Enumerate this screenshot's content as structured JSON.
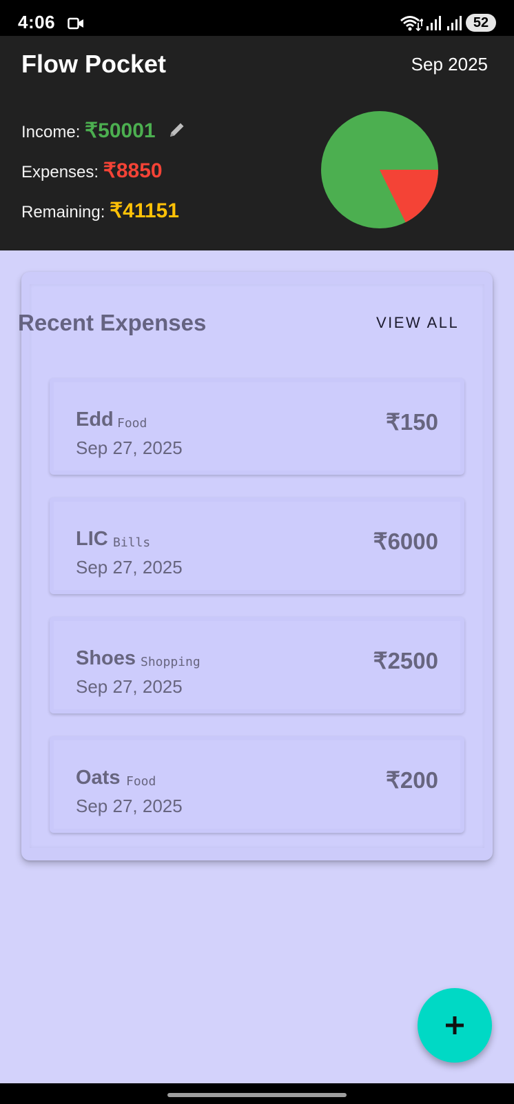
{
  "status_bar": {
    "time": "4:06",
    "battery": "52",
    "icons": [
      "video-camera-icon",
      "wifi-icon",
      "signal-icon",
      "signal-icon"
    ]
  },
  "header": {
    "title": "Flow Pocket",
    "month": "Sep 2025",
    "income_label": "Income: ",
    "income_value": "₹50001",
    "expenses_label": "Expenses: ",
    "expenses_value": "₹8850",
    "remaining_label": "Remaining: ",
    "remaining_value": "₹41151",
    "edit_icon": "pencil-icon"
  },
  "pie": {
    "income": 50001,
    "expenses": 8850,
    "colors": {
      "remaining": "#4caf50",
      "expenses": "#f44336"
    }
  },
  "recent": {
    "title": "Recent Expenses",
    "view_all": "VIEW ALL",
    "items": [
      {
        "name": "Edd",
        "category": "Food",
        "date": "Sep 27, 2025",
        "amount": "₹150"
      },
      {
        "name": "LIC",
        "category": "Bills",
        "date": "Sep 27, 2025",
        "amount": "₹6000"
      },
      {
        "name": "Shoes",
        "category": "Shopping",
        "date": "Sep 27, 2025",
        "amount": "₹2500"
      },
      {
        "name": "Oats",
        "category": "Food",
        "date": "Sep 27, 2025",
        "amount": "₹200"
      }
    ]
  },
  "fab": {
    "icon": "plus-icon",
    "color": "#00d9c5"
  },
  "colors": {
    "income": "#4caf50",
    "expenses": "#f44336",
    "remaining": "#ffc107",
    "background": "#d3d2fb",
    "header": "#212121"
  }
}
